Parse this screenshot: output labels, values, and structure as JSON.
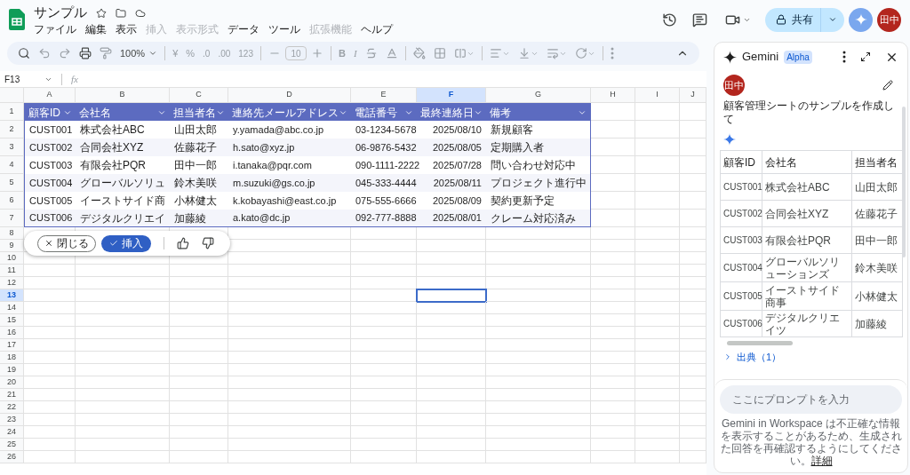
{
  "app": {
    "title": "サンプル"
  },
  "menu": [
    {
      "label": "ファイル",
      "disabled": false
    },
    {
      "label": "編集",
      "disabled": false
    },
    {
      "label": "表示",
      "disabled": false
    },
    {
      "label": "挿入",
      "disabled": true
    },
    {
      "label": "表示形式",
      "disabled": true
    },
    {
      "label": "データ",
      "disabled": false
    },
    {
      "label": "ツール",
      "disabled": false
    },
    {
      "label": "拡張機能",
      "disabled": true
    },
    {
      "label": "ヘルプ",
      "disabled": false
    }
  ],
  "share": {
    "label": "共有"
  },
  "account": {
    "initials": "田中"
  },
  "toolbar": {
    "zoom": "100%",
    "currency": "¥",
    "percent": "%",
    "decrease_decimals": ".0",
    "increase_decimals": ".00",
    "number_format": "123",
    "font_size": "10",
    "bold": "B",
    "italic": "I"
  },
  "formula_bar": {
    "cell": "F13",
    "fx": "fx"
  },
  "columns": [
    {
      "label": "A",
      "selected": false
    },
    {
      "label": "B",
      "selected": false
    },
    {
      "label": "C",
      "selected": false
    },
    {
      "label": "D",
      "selected": false
    },
    {
      "label": "E",
      "selected": false
    },
    {
      "label": "F",
      "selected": true
    },
    {
      "label": "G",
      "selected": false
    },
    {
      "label": "H",
      "selected": false
    },
    {
      "label": "I",
      "selected": false
    },
    {
      "label": "J",
      "selected": false
    }
  ],
  "rows": [
    {
      "label": "1",
      "selected": false
    },
    {
      "label": "2",
      "selected": false
    },
    {
      "label": "3",
      "selected": false
    },
    {
      "label": "4",
      "selected": false
    },
    {
      "label": "5",
      "selected": false
    },
    {
      "label": "6",
      "selected": false
    },
    {
      "label": "7",
      "selected": false
    },
    {
      "label": "8",
      "selected": false
    },
    {
      "label": "9",
      "selected": false
    },
    {
      "label": "10",
      "selected": false
    },
    {
      "label": "11",
      "selected": false
    },
    {
      "label": "12",
      "selected": false
    },
    {
      "label": "13",
      "selected": true
    },
    {
      "label": "14",
      "selected": false
    },
    {
      "label": "15",
      "selected": false
    },
    {
      "label": "16",
      "selected": false
    },
    {
      "label": "17",
      "selected": false
    },
    {
      "label": "18",
      "selected": false
    },
    {
      "label": "19",
      "selected": false
    },
    {
      "label": "20",
      "selected": false
    },
    {
      "label": "21",
      "selected": false
    },
    {
      "label": "22",
      "selected": false
    },
    {
      "label": "23",
      "selected": false
    },
    {
      "label": "24",
      "selected": false
    },
    {
      "label": "25",
      "selected": false
    },
    {
      "label": "26",
      "selected": false
    }
  ],
  "sheet": {
    "header": [
      "顧客ID",
      "会社名",
      "担当者名",
      "連絡先メールアドレス",
      "電話番号",
      "最終連絡日",
      "備考"
    ],
    "rows": [
      [
        "CUST001",
        "株式会社ABC",
        "山田太郎",
        "y.yamada@abc.co.jp",
        "03-1234-5678",
        "2025/08/10",
        "新規顧客"
      ],
      [
        "CUST002",
        "合同会社XYZ",
        "佐藤花子",
        "h.sato@xyz.jp",
        "06-9876-5432",
        "2025/08/05",
        "定期購入者"
      ],
      [
        "CUST003",
        "有限会社PQR",
        "田中一郎",
        "i.tanaka@pqr.com",
        "090-1111-2222",
        "2025/07/28",
        "問い合わせ対応中"
      ],
      [
        "CUST004",
        "グローバルソリュ",
        "鈴木美咲",
        "m.suzuki@gs.co.jp",
        "045-333-4444",
        "2025/08/11",
        "プロジェクト進行中"
      ],
      [
        "CUST005",
        "イーストサイド商",
        "小林健太",
        "k.kobayashi@east.co.jp",
        "075-555-6666",
        "2025/08/09",
        "契約更新予定"
      ],
      [
        "CUST006",
        "デジタルクリエイ",
        "加藤綾",
        "a.kato@dc.jp",
        "092-777-8888",
        "2025/08/01",
        "クレーム対応済み"
      ]
    ]
  },
  "inline_actions": {
    "close": "閉じる",
    "insert": "挿入"
  },
  "gemini": {
    "title": "Gemini",
    "badge": "Alpha",
    "user_initials": "田中",
    "prompt": "顧客管理シートのサンプルを作成して",
    "table": {
      "columns": [
        "顧客ID",
        "会社名",
        "担当者名"
      ],
      "rows": [
        [
          "CUST001",
          "株式会社ABC",
          "山田太郎"
        ],
        [
          "CUST002",
          "合同会社XYZ",
          "佐藤花子"
        ],
        [
          "CUST003",
          "有限会社PQR",
          "田中一郎"
        ],
        [
          "CUST004",
          "グローバルソリューションズ",
          "鈴木美咲"
        ],
        [
          "CUST005",
          "イーストサイド商事",
          "小林健太"
        ],
        [
          "CUST006",
          "デジタルクリエイツ",
          "加藤綾"
        ]
      ]
    },
    "sources": {
      "label": "出典（1）",
      "expanded": false
    },
    "input": {
      "placeholder": "ここにプロンプトを入力"
    },
    "disclaimer": "Gemini in Workspace は不正確な情報を表示することがあるため、生成された回答を再確認するようにしてください。",
    "disclaimer_link": "詳細"
  }
}
